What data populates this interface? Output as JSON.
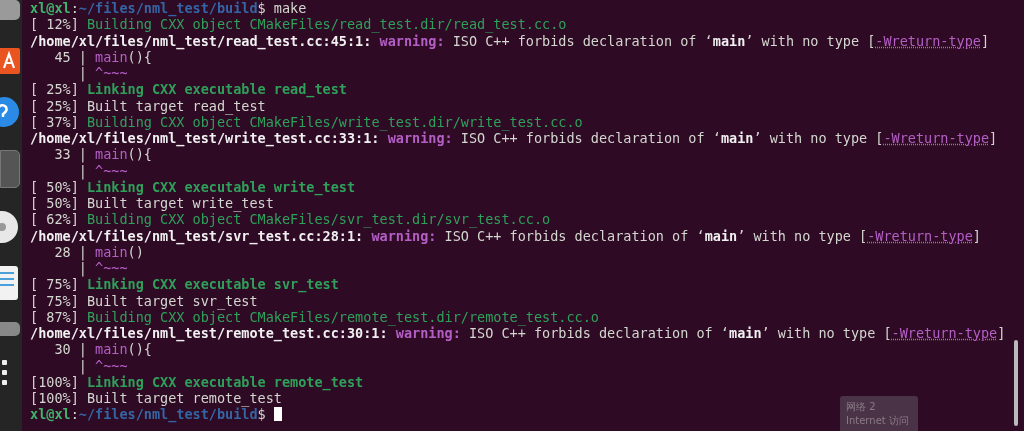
{
  "dock": {
    "items": [
      {
        "kind": "grey"
      },
      {
        "kind": "software"
      },
      {
        "kind": "help"
      },
      {
        "kind": "active"
      },
      {
        "kind": "disc"
      },
      {
        "kind": "document"
      },
      {
        "kind": "grey2"
      },
      {
        "kind": "apps"
      }
    ]
  },
  "terminal": {
    "lines": [
      [
        {
          "kind": "user",
          "text": "xl@xl"
        },
        {
          "kind": "plain",
          "text": ":"
        },
        {
          "kind": "path",
          "text": "~/files/nml_test/build"
        },
        {
          "kind": "plain",
          "text": "$ make"
        }
      ],
      [
        {
          "kind": "plain",
          "text": "[ 12%] "
        },
        {
          "kind": "green",
          "text": "Building CXX object CMakeFiles/read_test.dir/read_test.cc.o"
        }
      ],
      [
        {
          "kind": "bold",
          "text": "/home/xl/files/nml_test/read_test.cc:45:1:"
        },
        {
          "kind": "warn",
          "text": " warning:"
        },
        {
          "kind": "plain",
          "text": " ISO C++ forbids declaration of ‘"
        },
        {
          "kind": "bold",
          "text": "main"
        },
        {
          "kind": "plain",
          "text": "’ with no type ["
        },
        {
          "kind": "flag",
          "text": "-Wreturn-type"
        },
        {
          "kind": "plain",
          "text": "]"
        }
      ],
      [
        {
          "kind": "plain",
          "text": "   45 | "
        },
        {
          "kind": "purple",
          "text": "main"
        },
        {
          "kind": "plain",
          "text": "(){"
        }
      ],
      [
        {
          "kind": "plain",
          "text": "      | "
        },
        {
          "kind": "purple",
          "text": "^~~~"
        }
      ],
      [
        {
          "kind": "plain",
          "text": "[ 25%] "
        },
        {
          "kind": "greenbold",
          "text": "Linking CXX executable read_test"
        }
      ],
      [
        {
          "kind": "plain",
          "text": "[ 25%] Built target read_test"
        }
      ],
      [
        {
          "kind": "plain",
          "text": "[ 37%] "
        },
        {
          "kind": "green",
          "text": "Building CXX object CMakeFiles/write_test.dir/write_test.cc.o"
        }
      ],
      [
        {
          "kind": "bold",
          "text": "/home/xl/files/nml_test/write_test.cc:33:1:"
        },
        {
          "kind": "warn",
          "text": " warning:"
        },
        {
          "kind": "plain",
          "text": " ISO C++ forbids declaration of ‘"
        },
        {
          "kind": "bold",
          "text": "main"
        },
        {
          "kind": "plain",
          "text": "’ with no type ["
        },
        {
          "kind": "flag",
          "text": "-Wreturn-type"
        },
        {
          "kind": "plain",
          "text": "]"
        }
      ],
      [
        {
          "kind": "plain",
          "text": "   33 | "
        },
        {
          "kind": "purple",
          "text": "main"
        },
        {
          "kind": "plain",
          "text": "(){"
        }
      ],
      [
        {
          "kind": "plain",
          "text": "      | "
        },
        {
          "kind": "purple",
          "text": "^~~~"
        }
      ],
      [
        {
          "kind": "plain",
          "text": "[ 50%] "
        },
        {
          "kind": "greenbold",
          "text": "Linking CXX executable write_test"
        }
      ],
      [
        {
          "kind": "plain",
          "text": "[ 50%] Built target write_test"
        }
      ],
      [
        {
          "kind": "plain",
          "text": "[ 62%] "
        },
        {
          "kind": "green",
          "text": "Building CXX object CMakeFiles/svr_test.dir/svr_test.cc.o"
        }
      ],
      [
        {
          "kind": "bold",
          "text": "/home/xl/files/nml_test/svr_test.cc:28:1:"
        },
        {
          "kind": "warn",
          "text": " warning:"
        },
        {
          "kind": "plain",
          "text": " ISO C++ forbids declaration of ‘"
        },
        {
          "kind": "bold",
          "text": "main"
        },
        {
          "kind": "plain",
          "text": "’ with no type ["
        },
        {
          "kind": "flag",
          "text": "-Wreturn-type"
        },
        {
          "kind": "plain",
          "text": "]"
        }
      ],
      [
        {
          "kind": "plain",
          "text": "   28 | "
        },
        {
          "kind": "purple",
          "text": "main"
        },
        {
          "kind": "plain",
          "text": "()"
        }
      ],
      [
        {
          "kind": "plain",
          "text": "      | "
        },
        {
          "kind": "purple",
          "text": "^~~~"
        }
      ],
      [
        {
          "kind": "plain",
          "text": "[ 75%] "
        },
        {
          "kind": "greenbold",
          "text": "Linking CXX executable svr_test"
        }
      ],
      [
        {
          "kind": "plain",
          "text": "[ 75%] Built target svr_test"
        }
      ],
      [
        {
          "kind": "plain",
          "text": "[ 87%] "
        },
        {
          "kind": "green",
          "text": "Building CXX object CMakeFiles/remote_test.dir/remote_test.cc.o"
        }
      ],
      [
        {
          "kind": "bold",
          "text": "/home/xl/files/nml_test/remote_test.cc:30:1:"
        },
        {
          "kind": "warn",
          "text": " warning:"
        },
        {
          "kind": "plain",
          "text": " ISO C++ forbids declaration of ‘"
        },
        {
          "kind": "bold",
          "text": "main"
        },
        {
          "kind": "plain",
          "text": "’ with no type ["
        },
        {
          "kind": "flag",
          "text": "-Wreturn-type"
        },
        {
          "kind": "plain",
          "text": "]"
        }
      ],
      [
        {
          "kind": "plain",
          "text": "   30 | "
        },
        {
          "kind": "purple",
          "text": "main"
        },
        {
          "kind": "plain",
          "text": "(){"
        }
      ],
      [
        {
          "kind": "plain",
          "text": "      | "
        },
        {
          "kind": "purple",
          "text": "^~~~"
        }
      ],
      [
        {
          "kind": "plain",
          "text": "[100%] "
        },
        {
          "kind": "greenbold",
          "text": "Linking CXX executable remote_test"
        }
      ],
      [
        {
          "kind": "plain",
          "text": "[100%] Built target remote_test"
        }
      ],
      [
        {
          "kind": "user",
          "text": "xl@xl"
        },
        {
          "kind": "plain",
          "text": ":"
        },
        {
          "kind": "path",
          "text": "~/files/nml_test/build"
        },
        {
          "kind": "plain",
          "text": "$"
        }
      ]
    ]
  },
  "notification": {
    "title": "网络 2",
    "subtitle": "Internet 访问"
  }
}
